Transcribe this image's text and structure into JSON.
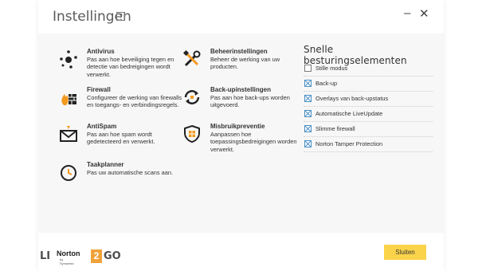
{
  "window": {
    "title": "Instellingen",
    "help_label": "?",
    "minimize": "–",
    "close": "✕"
  },
  "settings": [
    {
      "title": "Antivirus",
      "desc": "Pas aan hoe beveiliging tegen en detectie van bedreigingen wordt verwerkt.",
      "icon": "antivirus-icon"
    },
    {
      "title": "Beheerinstellingen",
      "desc": "Beheer de werking van uw producten.",
      "icon": "wrench-screwdriver-icon"
    },
    {
      "title": "Firewall",
      "desc": "Configureer de werking van firewalls en toegangs- en verbindingsregels.",
      "icon": "firewall-icon"
    },
    {
      "title": "Back-upinstellingen",
      "desc": "Pas aan hoe back-ups worden uitgevoerd.",
      "icon": "backup-icon"
    },
    {
      "title": "AntiSpam",
      "desc": "Pas aan hoe spam wordt gedetecteerd en verwerkt.",
      "icon": "antispam-envelope-icon"
    },
    {
      "title": "Misbruikpreventie",
      "desc": "Aanpassen hoe toepassingsbedreigingen worden verwerkt.",
      "icon": "shield-grid-icon"
    },
    {
      "title": "Taakplanner",
      "desc": "Pas uw automatische scans aan.",
      "icon": "clock-icon"
    }
  ],
  "quick": {
    "heading": "Snelle besturingselementen",
    "items": [
      {
        "label": "Stille modus",
        "checked": false
      },
      {
        "label": "Back-up",
        "checked": true
      },
      {
        "label": "Overlays van back-upstatus",
        "checked": true
      },
      {
        "label": "Automatische LiveUpdate",
        "checked": true
      },
      {
        "label": "Slimme firewall",
        "checked": true
      },
      {
        "label": "Norton Tamper Protection",
        "checked": true
      }
    ]
  },
  "footer": {
    "close_label": "Sluiten"
  },
  "logo": {
    "left": "LI",
    "brand": "Norton",
    "brand_sub": "by Symantec",
    "num": "2",
    "right": "GO"
  },
  "colors": {
    "accent_button": "#fbd34a",
    "checkbox": "#3a86c4",
    "firewall_orange": "#f29a1f"
  }
}
